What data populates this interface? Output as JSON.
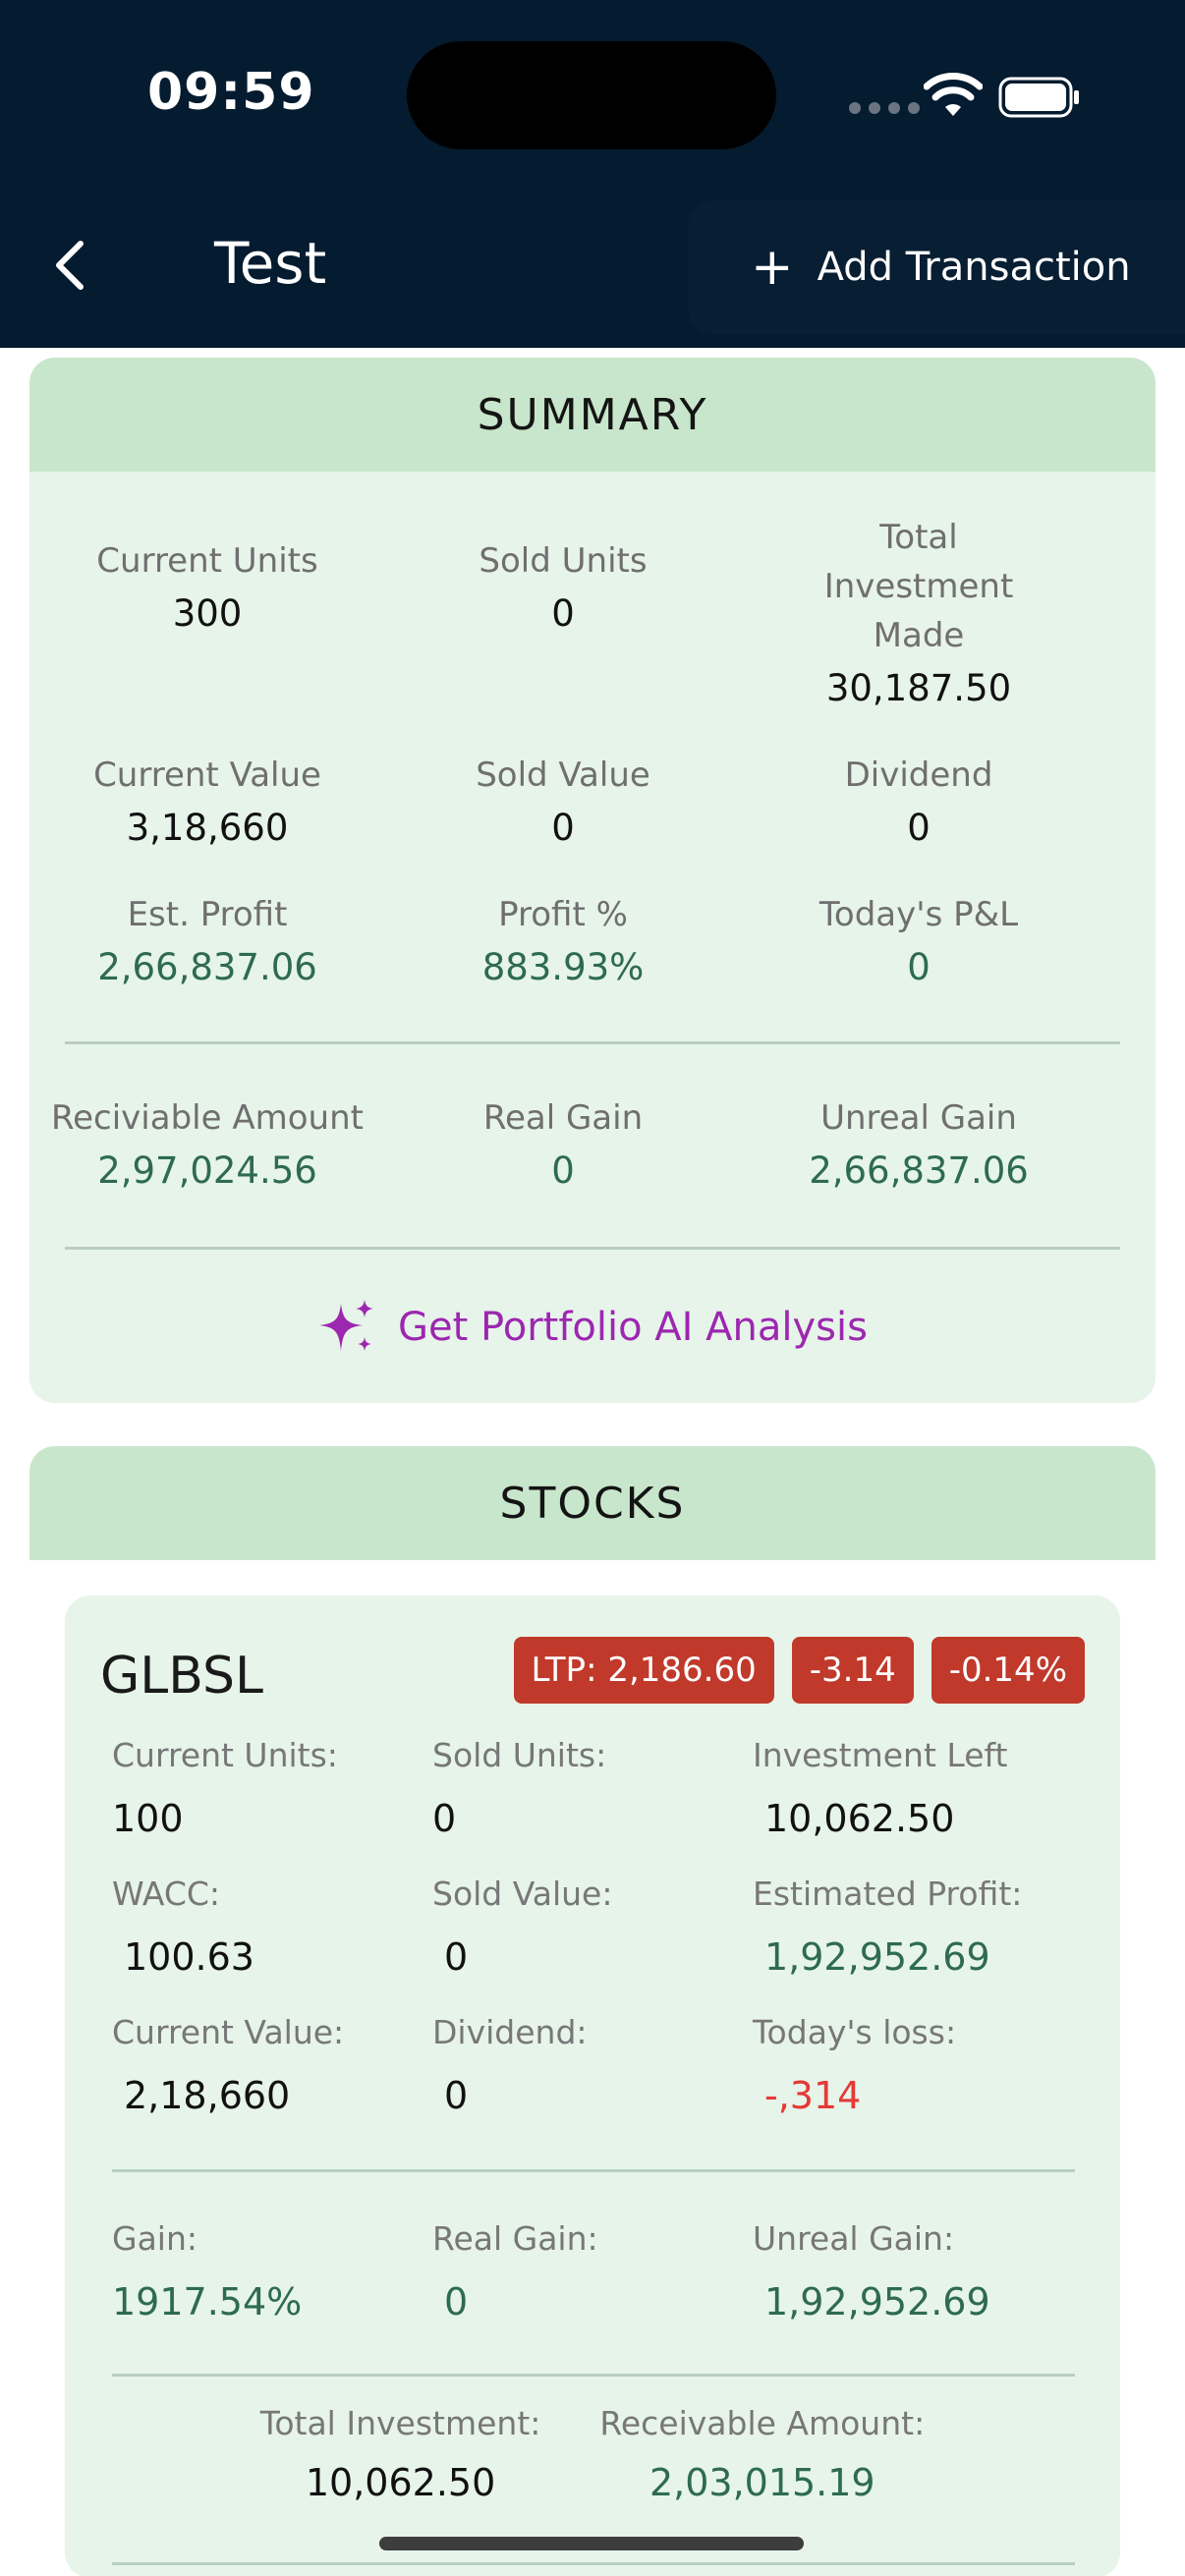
{
  "status_bar": {
    "time": "09:59"
  },
  "header": {
    "title": "Test",
    "add_transaction": "Add Transaction"
  },
  "summary": {
    "title": "SUMMARY",
    "row1": [
      {
        "label": "Current Units",
        "value": "300"
      },
      {
        "label": "Sold Units",
        "value": "0"
      },
      {
        "label": "Total Investment Made",
        "value": "30,187.50"
      }
    ],
    "row2": [
      {
        "label": "Current Value",
        "value": "3,18,660"
      },
      {
        "label": "Sold Value",
        "value": "0"
      },
      {
        "label": "Dividend",
        "value": "0"
      }
    ],
    "row3": [
      {
        "label": "Est. Profit",
        "value": "2,66,837.06"
      },
      {
        "label": "Profit %",
        "value": "883.93%"
      },
      {
        "label": "Today's P&L",
        "value": "0"
      }
    ],
    "row4": [
      {
        "label": "Reciviable Amount",
        "value": "2,97,024.56"
      },
      {
        "label": "Real Gain",
        "value": "0"
      },
      {
        "label": "Unreal Gain",
        "value": "2,66,837.06"
      }
    ],
    "ai_link": "Get Portfolio AI Analysis"
  },
  "stocks": {
    "title": "STOCKS",
    "items": [
      {
        "ticker": "GLBSL",
        "ltp": "LTP: 2,186.60",
        "change": "-3.14",
        "change_pct": "-0.14%",
        "row1": [
          {
            "label": "Current Units:",
            "value": "100"
          },
          {
            "label": "Sold Units:",
            "value": "0"
          },
          {
            "label": "Investment Left",
            "value": "10,062.50"
          }
        ],
        "row2": [
          {
            "label": "WACC:",
            "value": "100.63"
          },
          {
            "label": "Sold Value:",
            "value": "0"
          },
          {
            "label": "Estimated Profit:",
            "value": "1,92,952.69"
          }
        ],
        "row3": [
          {
            "label": "Current Value:",
            "value": "2,18,660"
          },
          {
            "label": "Dividend:",
            "value": "0"
          },
          {
            "label": "Today's loss:",
            "value": "-,314"
          }
        ],
        "row4": [
          {
            "label": "Gain:",
            "value": "1917.54%"
          },
          {
            "label": "Real Gain:",
            "value": "0"
          },
          {
            "label": "Unreal Gain:",
            "value": "1,92,952.69"
          }
        ],
        "totals": [
          {
            "label": "Total Investment:",
            "value": "10,062.50"
          },
          {
            "label": "Receivable Amount:",
            "value": "2,03,015.19"
          }
        ]
      }
    ]
  },
  "colors": {
    "accent_purple": "#9c27b0",
    "negative": "#c0392b",
    "positive": "#2e6b50",
    "header_bg": "#041b30"
  }
}
